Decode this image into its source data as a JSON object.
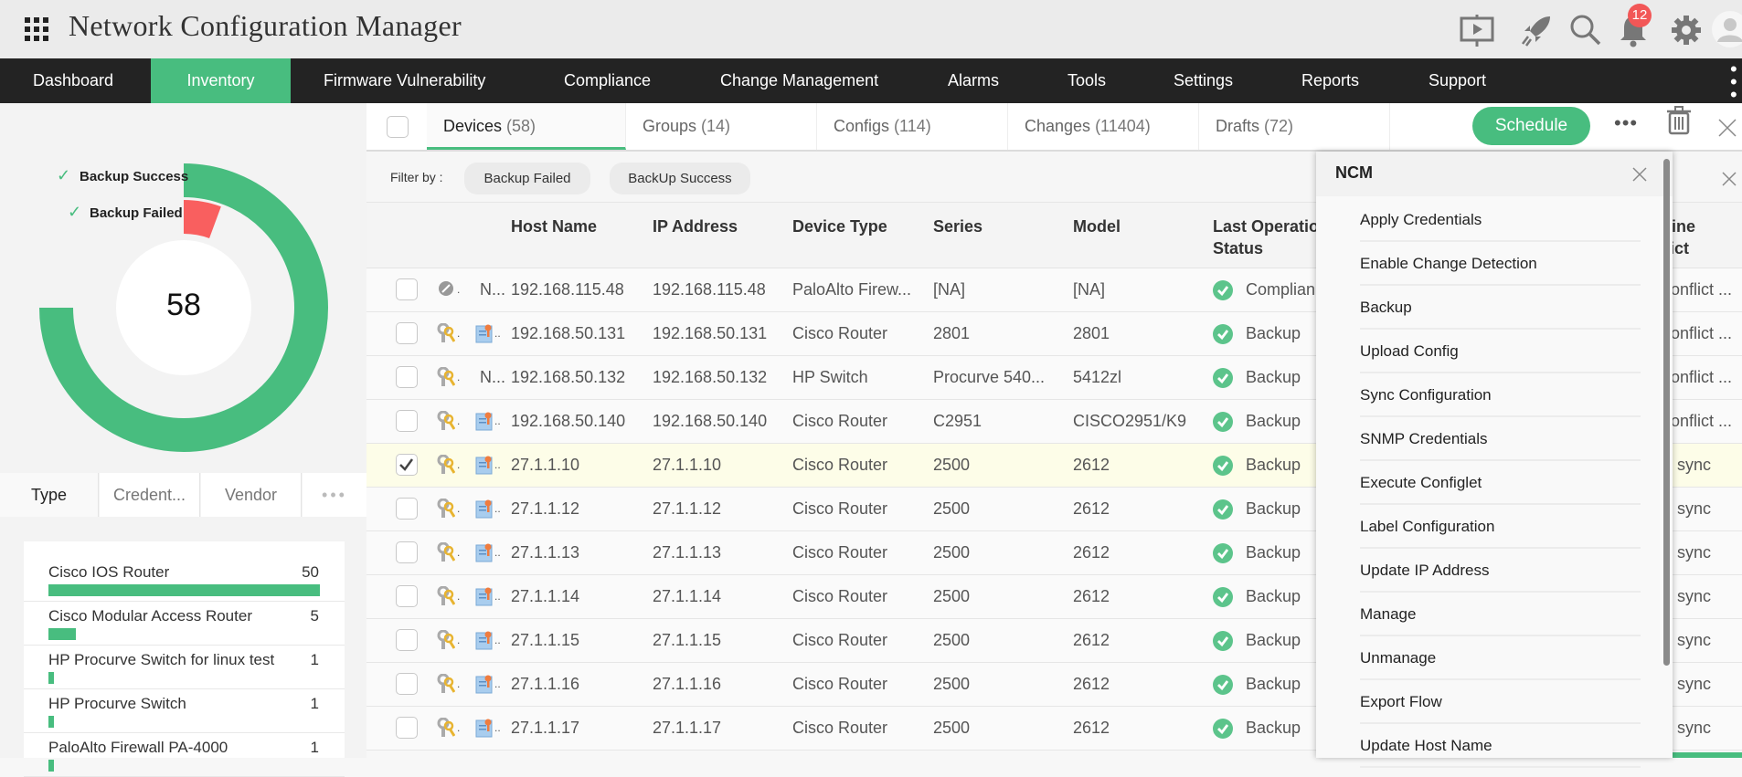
{
  "app": {
    "title": "Network Configuration Manager",
    "notification_count": "12"
  },
  "header_icons": [
    "grid-apps-icon",
    "presentation-icon",
    "rocket-icon",
    "search-icon",
    "bell-icon",
    "gear-icon",
    "user-avatar-icon"
  ],
  "nav": {
    "items": [
      "Dashboard",
      "Inventory",
      "Firmware Vulnerability",
      "Compliance",
      "Change Management",
      "Alarms",
      "Tools",
      "Settings",
      "Reports",
      "Support"
    ],
    "active": "Inventory"
  },
  "donut": {
    "total": "58",
    "legend": [
      "Backup Success",
      "Backup Failed"
    ],
    "segments": [
      {
        "label": "Backup Success",
        "fraction_of_sweep": 1.0,
        "color": "#48bd7f"
      },
      {
        "label": "Backup Failed",
        "fraction_of_sweep": 0.075,
        "color": "#f95f5f"
      }
    ]
  },
  "left_tabs": [
    "Type",
    "Credent...",
    "Vendor"
  ],
  "type_list": [
    {
      "label": "Cisco IOS Router",
      "count": 50
    },
    {
      "label": "Cisco Modular Access Router",
      "count": 5
    },
    {
      "label": "HP Procurve Switch for linux test",
      "count": 1
    },
    {
      "label": "HP Procurve Switch",
      "count": 1
    },
    {
      "label": "PaloAlto Firewall PA-4000",
      "count": 1
    }
  ],
  "tabs": [
    {
      "label": "Devices",
      "count": "(58)"
    },
    {
      "label": "Groups",
      "count": "(14)"
    },
    {
      "label": "Configs",
      "count": "(114)"
    },
    {
      "label": "Changes",
      "count": "(11404)"
    },
    {
      "label": "Drafts",
      "count": "(72)"
    }
  ],
  "toolbar": {
    "schedule": "Schedule"
  },
  "filter": {
    "label": "Filter by :",
    "chips": [
      "Backup Failed",
      "BackUp Success"
    ]
  },
  "columns": [
    "Host Name",
    "IP Address",
    "Device Type",
    "Series",
    "Model",
    "Last Operation\nStatus",
    "Baseline\nConflict"
  ],
  "rows": [
    {
      "checked": false,
      "icon": "unmanaged",
      "name": "N...",
      "host": "192.168.115.48",
      "ip": "192.168.115.48",
      "type": "PaloAlto Firew...",
      "series": "[NA]",
      "model": "[NA]",
      "status": "Complian...",
      "baseline": "Conflict ..."
    },
    {
      "checked": false,
      "icon": "cert",
      "host": "192.168.50.131",
      "ip": "192.168.50.131",
      "type": "Cisco Router",
      "series": "2801",
      "model": "2801",
      "status": "Backup",
      "baseline": "Conflict ..."
    },
    {
      "checked": false,
      "icon": "key",
      "name": "N...",
      "host": "192.168.50.132",
      "ip": "192.168.50.132",
      "type": "HP Switch",
      "series": "Procurve 540...",
      "model": "5412zl",
      "status": "Backup",
      "baseline": "Conflict ..."
    },
    {
      "checked": false,
      "icon": "cert",
      "host": "192.168.50.140",
      "ip": "192.168.50.140",
      "type": "Cisco Router",
      "series": "C2951",
      "model": "CISCO2951/K9",
      "status": "Backup",
      "baseline": "Conflict ..."
    },
    {
      "checked": true,
      "icon": "cert",
      "host": "27.1.1.10",
      "ip": "27.1.1.10",
      "type": "Cisco Router",
      "series": "2500",
      "model": "2612",
      "status": "Backup",
      "baseline": "In sync"
    },
    {
      "checked": false,
      "icon": "cert",
      "host": "27.1.1.12",
      "ip": "27.1.1.12",
      "type": "Cisco Router",
      "series": "2500",
      "model": "2612",
      "status": "Backup",
      "baseline": "In sync"
    },
    {
      "checked": false,
      "icon": "cert",
      "host": "27.1.1.13",
      "ip": "27.1.1.13",
      "type": "Cisco Router",
      "series": "2500",
      "model": "2612",
      "status": "Backup",
      "baseline": "In sync"
    },
    {
      "checked": false,
      "icon": "cert",
      "host": "27.1.1.14",
      "ip": "27.1.1.14",
      "type": "Cisco Router",
      "series": "2500",
      "model": "2612",
      "status": "Backup",
      "baseline": "In sync"
    },
    {
      "checked": false,
      "icon": "cert",
      "host": "27.1.1.15",
      "ip": "27.1.1.15",
      "type": "Cisco Router",
      "series": "2500",
      "model": "2612",
      "status": "Backup",
      "baseline": "In sync"
    },
    {
      "checked": false,
      "icon": "cert",
      "host": "27.1.1.16",
      "ip": "27.1.1.16",
      "type": "Cisco Router",
      "series": "2500",
      "model": "2612",
      "status": "Backup",
      "baseline": "In sync"
    },
    {
      "checked": false,
      "icon": "cert",
      "host": "27.1.1.17",
      "ip": "27.1.1.17",
      "type": "Cisco Router",
      "series": "2500",
      "model": "2612",
      "status": "Backup",
      "baseline": "In sync"
    }
  ],
  "menu": {
    "title": "NCM",
    "items": [
      "Apply Credentials",
      "Enable Change Detection",
      "Backup",
      "Upload Config",
      "Sync Configuration",
      "SNMP Credentials",
      "Execute Configlet",
      "Label Configuration",
      "Update IP Address",
      "Manage",
      "Unmanage",
      "Export Flow",
      "Update Host Name"
    ]
  },
  "colors": {
    "accent": "#48bd7f",
    "failed": "#f95f5f",
    "nav_bg": "#232323",
    "badge": "#f25757",
    "selected_row": "#fdfde8"
  }
}
